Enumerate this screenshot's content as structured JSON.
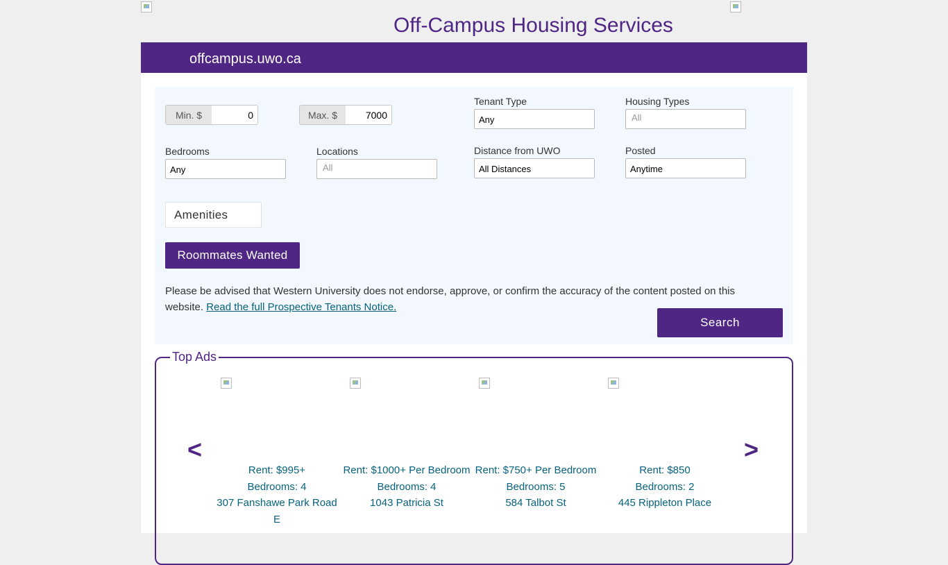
{
  "header": {
    "title": "Off-Campus Housing Services",
    "domain": "offcampus.uwo.ca"
  },
  "search": {
    "min_label": "Min. $",
    "min_value": "0",
    "max_label": "Max. $",
    "max_value": "7000",
    "tenant_type_label": "Tenant Type",
    "tenant_type_value": "Any",
    "housing_types_label": "Housing Types",
    "housing_types_placeholder": "All",
    "bedrooms_label": "Bedrooms",
    "bedrooms_value": "Any",
    "locations_label": "Locations",
    "locations_placeholder": "All",
    "distance_label": "Distance from UWO",
    "distance_value": "All Distances",
    "posted_label": "Posted",
    "posted_value": "Anytime",
    "amenities_label": "Amenities",
    "roommates_label": "Roommates Wanted",
    "notice_text": "Please be advised that Western University does not endorse, approve, or confirm the accuracy of the content posted on this website.",
    "notice_link": "Read the full Prospective Tenants Notice.",
    "search_label": "Search"
  },
  "top_ads": {
    "legend": "Top Ads",
    "prev": "<",
    "next": ">",
    "ads": [
      {
        "rent": "Rent: $995+",
        "bedrooms": "Bedrooms: 4",
        "address": "307 Fanshawe Park Road E"
      },
      {
        "rent": "Rent: $1000+ Per Bedroom",
        "bedrooms": "Bedrooms: 4",
        "address": "1043 Patricia St"
      },
      {
        "rent": "Rent: $750+ Per Bedroom",
        "bedrooms": "Bedrooms: 5",
        "address": "584 Talbot St"
      },
      {
        "rent": "Rent: $850",
        "bedrooms": "Bedrooms: 2",
        "address": "445 Rippleton Place"
      }
    ]
  },
  "colors": {
    "brand_purple": "#4f2683",
    "link_teal": "#07627d",
    "panel_bg": "#f2f8fd"
  }
}
